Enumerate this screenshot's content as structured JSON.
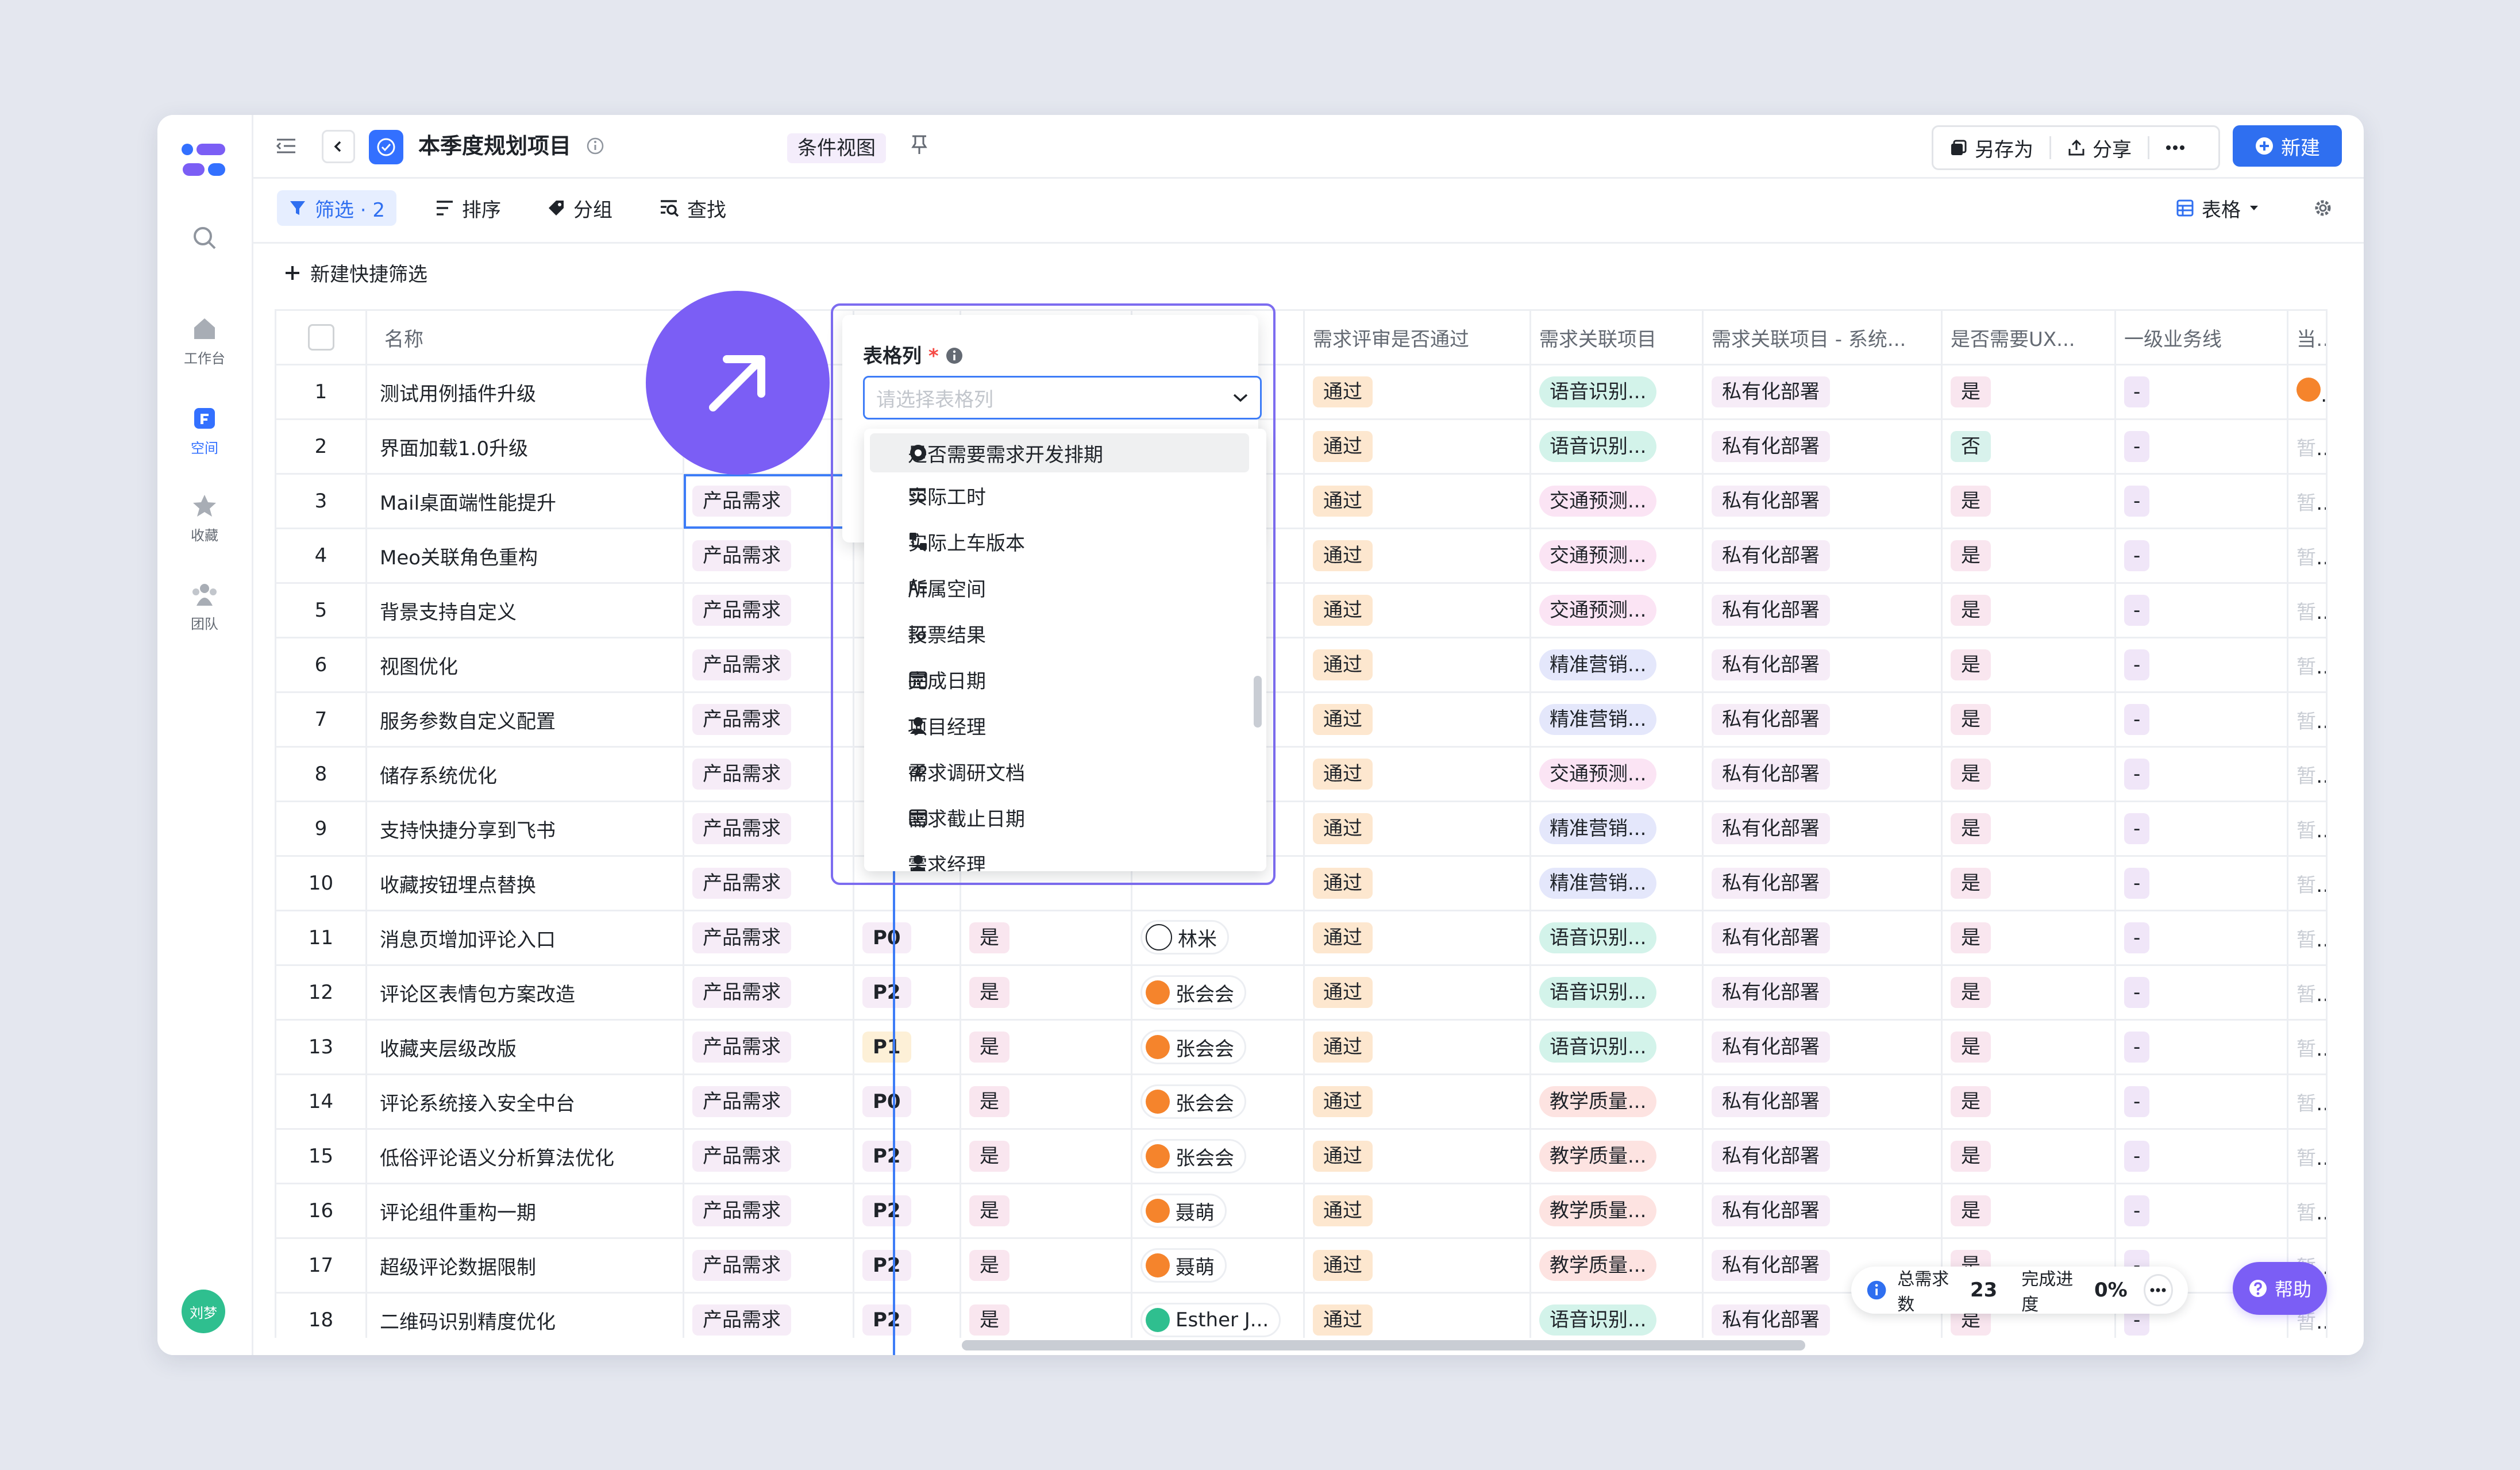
{
  "header": {
    "title": "本季度规划项目",
    "view_label": "条件视图",
    "save_as": "另存为",
    "share": "分享",
    "new": "新建"
  },
  "nav": {
    "items": [
      {
        "label": "工作台"
      },
      {
        "label": "空间"
      },
      {
        "label": "收藏"
      },
      {
        "label": "团队"
      }
    ],
    "user_initials": "刘梦"
  },
  "toolbar": {
    "filter": "筛选 · 2",
    "sort": "排序",
    "group": "分组",
    "find": "查找",
    "view_type": "表格",
    "quick_filter": "新建快捷筛选"
  },
  "table": {
    "headers": {
      "name": "名称",
      "review": "需求评审是否通过",
      "project": "需求关联项目",
      "project_sys": "需求关联项目 - 系统...",
      "ux": "是否需要UX...",
      "biz": "一级业务线",
      "cur": "当前"
    },
    "rows": [
      {
        "idx": "1",
        "name": "测试用例插件升级",
        "type": "",
        "pri": "",
        "dev": "",
        "owner": "",
        "review": "通过",
        "proj": "语音识别...",
        "proj_c": "green",
        "dept": "私有化部署",
        "ux": "是",
        "biz": "-",
        "cur": ""
      },
      {
        "idx": "2",
        "name": "界面加载1.0升级",
        "type": "",
        "pri": "",
        "dev": "",
        "owner": "",
        "review": "通过",
        "proj": "语音识别...",
        "proj_c": "green",
        "dept": "私有化部署",
        "ux": "否",
        "biz": "-",
        "cur": "暂无"
      },
      {
        "idx": "3",
        "name": "Mail桌面端性能提升",
        "type": "产品需求",
        "pri": "",
        "dev": "",
        "owner": "",
        "review": "通过",
        "proj": "交通预测...",
        "proj_c": "pink",
        "dept": "私有化部署",
        "ux": "是",
        "biz": "-",
        "cur": "暂无"
      },
      {
        "idx": "4",
        "name": "Meo关联角色重构",
        "type": "产品需求",
        "pri": "",
        "dev": "",
        "owner": "",
        "review": "通过",
        "proj": "交通预测...",
        "proj_c": "pink",
        "dept": "私有化部署",
        "ux": "是",
        "biz": "-",
        "cur": "暂无"
      },
      {
        "idx": "5",
        "name": "背景支持自定义",
        "type": "产品需求",
        "pri": "",
        "dev": "",
        "owner": "",
        "review": "通过",
        "proj": "交通预测...",
        "proj_c": "pink",
        "dept": "私有化部署",
        "ux": "是",
        "biz": "-",
        "cur": "暂无"
      },
      {
        "idx": "6",
        "name": "视图优化",
        "type": "产品需求",
        "pri": "",
        "dev": "",
        "owner": "",
        "review": "通过",
        "proj": "精准营销...",
        "proj_c": "blue",
        "dept": "私有化部署",
        "ux": "是",
        "biz": "-",
        "cur": "暂无"
      },
      {
        "idx": "7",
        "name": "服务参数自定义配置",
        "type": "产品需求",
        "pri": "",
        "dev": "",
        "owner": "",
        "review": "通过",
        "proj": "精准营销...",
        "proj_c": "blue",
        "dept": "私有化部署",
        "ux": "是",
        "biz": "-",
        "cur": "暂无"
      },
      {
        "idx": "8",
        "name": "储存系统优化",
        "type": "产品需求",
        "pri": "",
        "dev": "",
        "owner": "",
        "review": "通过",
        "proj": "交通预测...",
        "proj_c": "pink",
        "dept": "私有化部署",
        "ux": "是",
        "biz": "-",
        "cur": "暂无"
      },
      {
        "idx": "9",
        "name": "支持快捷分享到飞书",
        "type": "产品需求",
        "pri": "",
        "dev": "",
        "owner": "",
        "review": "通过",
        "proj": "精准营销...",
        "proj_c": "blue",
        "dept": "私有化部署",
        "ux": "是",
        "biz": "-",
        "cur": "暂无"
      },
      {
        "idx": "10",
        "name": "收藏按钮埋点替换",
        "type": "产品需求",
        "pri": "",
        "dev": "",
        "owner": "",
        "review": "通过",
        "proj": "精准营销...",
        "proj_c": "blue",
        "dept": "私有化部署",
        "ux": "是",
        "biz": "-",
        "cur": "暂无"
      },
      {
        "idx": "11",
        "name": "消息页增加评论入口",
        "type": "产品需求",
        "pri": "P0",
        "dev": "是",
        "owner": "林米",
        "review": "通过",
        "proj": "语音识别...",
        "proj_c": "green",
        "dept": "私有化部署",
        "ux": "是",
        "biz": "-",
        "cur": "暂无"
      },
      {
        "idx": "12",
        "name": "评论区表情包方案改造",
        "type": "产品需求",
        "pri": "P2",
        "dev": "是",
        "owner": "张会会",
        "review": "通过",
        "proj": "语音识别...",
        "proj_c": "green",
        "dept": "私有化部署",
        "ux": "是",
        "biz": "-",
        "cur": "暂无"
      },
      {
        "idx": "13",
        "name": "收藏夹层级改版",
        "type": "产品需求",
        "pri": "P1",
        "dev": "是",
        "owner": "张会会",
        "review": "通过",
        "proj": "语音识别...",
        "proj_c": "green",
        "dept": "私有化部署",
        "ux": "是",
        "biz": "-",
        "cur": "暂无"
      },
      {
        "idx": "14",
        "name": "评论系统接入安全中台",
        "type": "产品需求",
        "pri": "P0",
        "dev": "是",
        "owner": "张会会",
        "review": "通过",
        "proj": "教学质量...",
        "proj_c": "red",
        "dept": "私有化部署",
        "ux": "是",
        "biz": "-",
        "cur": "暂无"
      },
      {
        "idx": "15",
        "name": "低俗评论语义分析算法优化",
        "type": "产品需求",
        "pri": "P2",
        "dev": "是",
        "owner": "张会会",
        "review": "通过",
        "proj": "教学质量...",
        "proj_c": "red",
        "dept": "私有化部署",
        "ux": "是",
        "biz": "-",
        "cur": "暂无"
      },
      {
        "idx": "16",
        "name": "评论组件重构一期",
        "type": "产品需求",
        "pri": "P2",
        "dev": "是",
        "owner": "聂萌",
        "review": "通过",
        "proj": "教学质量...",
        "proj_c": "red",
        "dept": "私有化部署",
        "ux": "是",
        "biz": "-",
        "cur": "暂无"
      },
      {
        "idx": "17",
        "name": "超级评论数据限制",
        "type": "产品需求",
        "pri": "P2",
        "dev": "是",
        "owner": "聂萌",
        "review": "通过",
        "proj": "教学质量...",
        "proj_c": "red",
        "dept": "私有化部署",
        "ux": "是",
        "biz": "-",
        "cur": "暂无"
      },
      {
        "idx": "18",
        "name": "二维码识别精度优化",
        "type": "产品需求",
        "pri": "P2",
        "dev": "是",
        "owner": "Esther J...",
        "review": "通过",
        "proj": "语音识别...",
        "proj_c": "green",
        "dept": "私有化部署",
        "ux": "是",
        "biz": "-",
        "cur": "暂无"
      }
    ]
  },
  "dropdown": {
    "label": "表格列",
    "required_mark": "*",
    "placeholder": "请选择表格列",
    "options": [
      {
        "label": "是否需要需求开发排期",
        "icon": "radio-icon"
      },
      {
        "label": "实际工时",
        "icon": "formula-icon"
      },
      {
        "label": "实际上车版本",
        "icon": "flow-icon"
      },
      {
        "label": "所属空间",
        "icon": "text-icon"
      },
      {
        "label": "投票结果",
        "icon": "formula-icon"
      },
      {
        "label": "完成日期",
        "icon": "calendar-icon"
      },
      {
        "label": "项目经理",
        "icon": "person-icon"
      },
      {
        "label": "需求调研文档",
        "icon": "link-icon"
      },
      {
        "label": "需求截止日期",
        "icon": "calendar-icon"
      },
      {
        "label": "需求经理",
        "icon": "person-icon"
      }
    ]
  },
  "status": {
    "total_label": "总需求数",
    "total": "23",
    "progress_label": "完成进度",
    "progress": "0%",
    "help": "帮助"
  },
  "colors": {
    "accent": "#2f6ff0",
    "purple": "#7b5ef5"
  }
}
